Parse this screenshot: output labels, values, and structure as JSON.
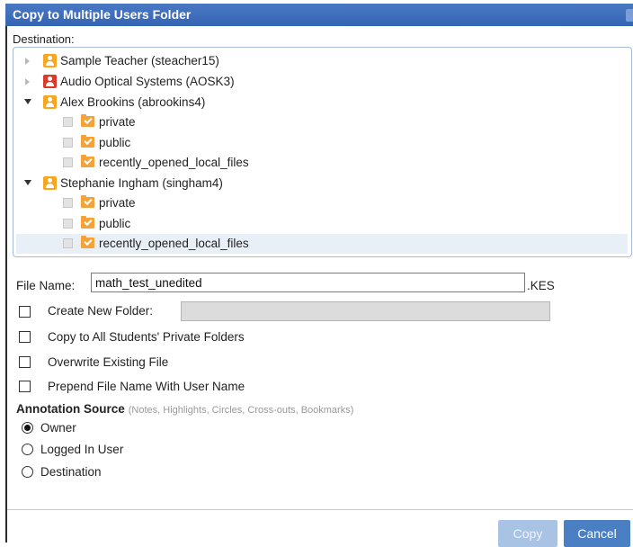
{
  "dialog": {
    "title": "Copy to Multiple Users Folder"
  },
  "destination": {
    "label": "Destination:",
    "tree": [
      {
        "label": "Sample Teacher (steacher15)",
        "icon": "user-orange",
        "expanded": false
      },
      {
        "label": "Audio Optical Systems (AOSK3)",
        "icon": "user-red",
        "expanded": false
      },
      {
        "label": "Alex Brookins (abrookins4)",
        "icon": "user-orange",
        "expanded": true,
        "folders": [
          "private",
          "public",
          "recently_opened_local_files"
        ]
      },
      {
        "label": "Stephanie Ingham (singham4)",
        "icon": "user-orange",
        "expanded": true,
        "folders": [
          "private",
          "public",
          "recently_opened_local_files"
        ]
      }
    ]
  },
  "file_name": {
    "label": "File Name:",
    "value": "math_test_unedited",
    "extension": ".KES"
  },
  "options": {
    "create_new_folder": "Create New Folder:",
    "copy_all_private": "Copy to All Students' Private Folders",
    "overwrite": "Overwrite Existing File",
    "prepend": "Prepend File Name With User Name"
  },
  "annotation": {
    "title": "Annotation Source",
    "hint": "(Notes, Highlights, Circles, Cross-outs, Bookmarks)",
    "options": [
      "Owner",
      "Logged In User",
      "Destination"
    ],
    "selected": "Owner"
  },
  "buttons": {
    "copy": "Copy",
    "cancel": "Cancel"
  },
  "colors": {
    "titlebar": "#3a6cb8",
    "button_primary": "#4a7fc4",
    "button_disabled": "#a8c3e4",
    "user_icon": "#f5a623",
    "user_icon_alt": "#d73c2c",
    "folder_icon": "#f3a33a"
  }
}
